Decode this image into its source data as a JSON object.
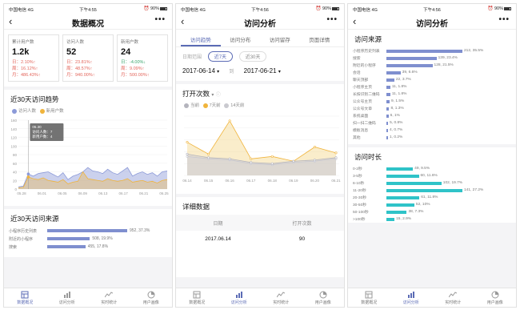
{
  "status_left": "中国电信 4G",
  "status_time_1": "下午4:55",
  "status_time_2": "下午4:56",
  "status_time_3": "下午4:56",
  "battery": "90%",
  "more_label": "•••",
  "tabbar": [
    "数据概况",
    "访问分析",
    "实时统计",
    "用户画像"
  ],
  "panel1": {
    "title": "数据概况",
    "stats": [
      {
        "label": "累计用户数",
        "value": "1.2k",
        "rows": [
          {
            "text": "日：2.10%↑",
            "color": "red"
          },
          {
            "text": "周：16.12%↑",
            "color": "red"
          },
          {
            "text": "月：486.43%↑",
            "color": "red"
          }
        ]
      },
      {
        "label": "访问人数",
        "value": "52",
        "rows": [
          {
            "text": "日：23.81%↑",
            "color": "red"
          },
          {
            "text": "周：48.57%↑",
            "color": "red"
          },
          {
            "text": "月：940.00%↑",
            "color": "red"
          }
        ]
      },
      {
        "label": "新用户数",
        "value": "24",
        "rows": [
          {
            "text": "日：-4.00%↓",
            "color": "green"
          },
          {
            "text": "周：9.09%↑",
            "color": "red"
          },
          {
            "text": "月：500.00%↑",
            "color": "red"
          }
        ]
      }
    ],
    "trend_title": "近30天访问趋势",
    "legend": [
      "访问人数",
      "新用户数"
    ],
    "tooltip": {
      "date": "05.30",
      "line1": "访问人数：7",
      "line2": "新用户数：4"
    },
    "source_title": "近30天访问来源",
    "sources": [
      {
        "name": "小程序历史列表",
        "value": "952, 37.3%",
        "ratio": 0.373
      },
      {
        "name": "附近的小程序",
        "value": "508, 19.9%",
        "ratio": 0.199
      },
      {
        "name": "搜索",
        "value": "455, 17.8%",
        "ratio": 0.178
      }
    ]
  },
  "panel2": {
    "title": "访问分析",
    "subtabs": [
      "访问趋势",
      "访问分布",
      "访问留存",
      "页面详情"
    ],
    "date_range_label": "日期范围",
    "range_options": [
      "近7天",
      "近30天"
    ],
    "date_from": "2017-06-14",
    "date_to_label": "到",
    "date_to": "2017-06-21",
    "metric_title": "打开次数",
    "legend": [
      "当前",
      "7天前",
      "14天前"
    ],
    "detail_title": "详细数据",
    "table_headers": [
      "日期",
      "打开次数"
    ],
    "table_rows": [
      {
        "date": "2017.06.14",
        "count": "90"
      }
    ]
  },
  "panel3": {
    "title": "访问分析",
    "source_title": "访问来源",
    "sources": [
      {
        "name": "小程序历史列表",
        "value": "212, 35.5%",
        "ratio": 0.355
      },
      {
        "name": "搜索",
        "value": "139, 23.4%",
        "ratio": 0.234
      },
      {
        "name": "附近的小程序",
        "value": "128, 21.5%",
        "ratio": 0.215
      },
      {
        "name": "会话",
        "value": "39, 6.6%",
        "ratio": 0.066
      },
      {
        "name": "聊天顶部",
        "value": "22, 3.7%",
        "ratio": 0.037
      },
      {
        "name": "小程序主页",
        "value": "11, 1.8%",
        "ratio": 0.018
      },
      {
        "name": "长按识别二维码",
        "value": "11, 1.8%",
        "ratio": 0.018
      },
      {
        "name": "公众号主页",
        "value": "9, 1.5%",
        "ratio": 0.015
      },
      {
        "name": "公众号文章",
        "value": "8, 1.3%",
        "ratio": 0.013
      },
      {
        "name": "系统桌面",
        "value": "6, 1%",
        "ratio": 0.01
      },
      {
        "name": "扫一扫二维码",
        "value": "5, 0.8%",
        "ratio": 0.008
      },
      {
        "name": "模板消息",
        "value": "4, 0.7%",
        "ratio": 0.007
      },
      {
        "name": "其他",
        "value": "1, 0.2%",
        "ratio": 0.002
      }
    ],
    "duration_title": "访问时长",
    "durations": [
      {
        "name": "0-2秒",
        "value": "49, 9.5%",
        "ratio": 0.095
      },
      {
        "name": "3-5秒",
        "value": "60, 11.6%",
        "ratio": 0.116
      },
      {
        "name": "6-10秒",
        "value": "102, 19.7%",
        "ratio": 0.197
      },
      {
        "name": "11-20秒",
        "value": "141, 27.2%",
        "ratio": 0.272
      },
      {
        "name": "20-30秒",
        "value": "61, 11.8%",
        "ratio": 0.118
      },
      {
        "name": "30-50秒",
        "value": "52, 10%",
        "ratio": 0.1
      },
      {
        "name": "50-100秒",
        "value": "38, 7.3%",
        "ratio": 0.073
      },
      {
        "name": ">100秒",
        "value": "15, 2.9%",
        "ratio": 0.029
      }
    ]
  },
  "colors": {
    "accent": "#5b6bb5",
    "blue_series": "#8c9ad8",
    "yellow_series": "#f0b43c",
    "gray_series": "#b4b4bd",
    "teal_bar": "#2fc3c8",
    "indigo_bar": "#7f8fcf",
    "up_red": "#e3655b",
    "down_green": "#3aa66d"
  },
  "chart_data": [
    {
      "type": "area",
      "categories": [
        "05.28",
        "06.01",
        "06.05",
        "06.09",
        "06.13",
        "06.17",
        "06.21",
        "06.25"
      ],
      "ylim": [
        0,
        160
      ],
      "yticks": [
        0,
        20,
        40,
        60,
        80,
        100,
        120,
        140,
        160
      ],
      "series": [
        {
          "name": "访问人数",
          "values": [
            5,
            7,
            35,
            30,
            36,
            38,
            40,
            34,
            28,
            38,
            22,
            30,
            34,
            40,
            50,
            42,
            40,
            36,
            46,
            38,
            34,
            42,
            50,
            30,
            36,
            40,
            34,
            38,
            30,
            40,
            42
          ]
        },
        {
          "name": "新用户数",
          "values": [
            3,
            4,
            28,
            24,
            22,
            26,
            20,
            18,
            16,
            22,
            12,
            16,
            18,
            40,
            24,
            22,
            20,
            18,
            24,
            20,
            18,
            20,
            24,
            16,
            18,
            20,
            16,
            18,
            14,
            20,
            22
          ]
        }
      ]
    },
    {
      "type": "line",
      "categories": [
        "06.14",
        "06.15",
        "06.16",
        "06.17",
        "06.18",
        "06.19",
        "06.20",
        "06.21"
      ],
      "ylim": [
        0,
        250
      ],
      "series": [
        {
          "name": "当前",
          "values": [
            90,
            75,
            70,
            55,
            50,
            60,
            65,
            75
          ]
        },
        {
          "name": "7天前",
          "values": [
            140,
            90,
            230,
            70,
            80,
            60,
            120,
            95
          ]
        },
        {
          "name": "14天前",
          "values": [
            80,
            70,
            65,
            50,
            45,
            55,
            60,
            70
          ]
        }
      ]
    }
  ]
}
